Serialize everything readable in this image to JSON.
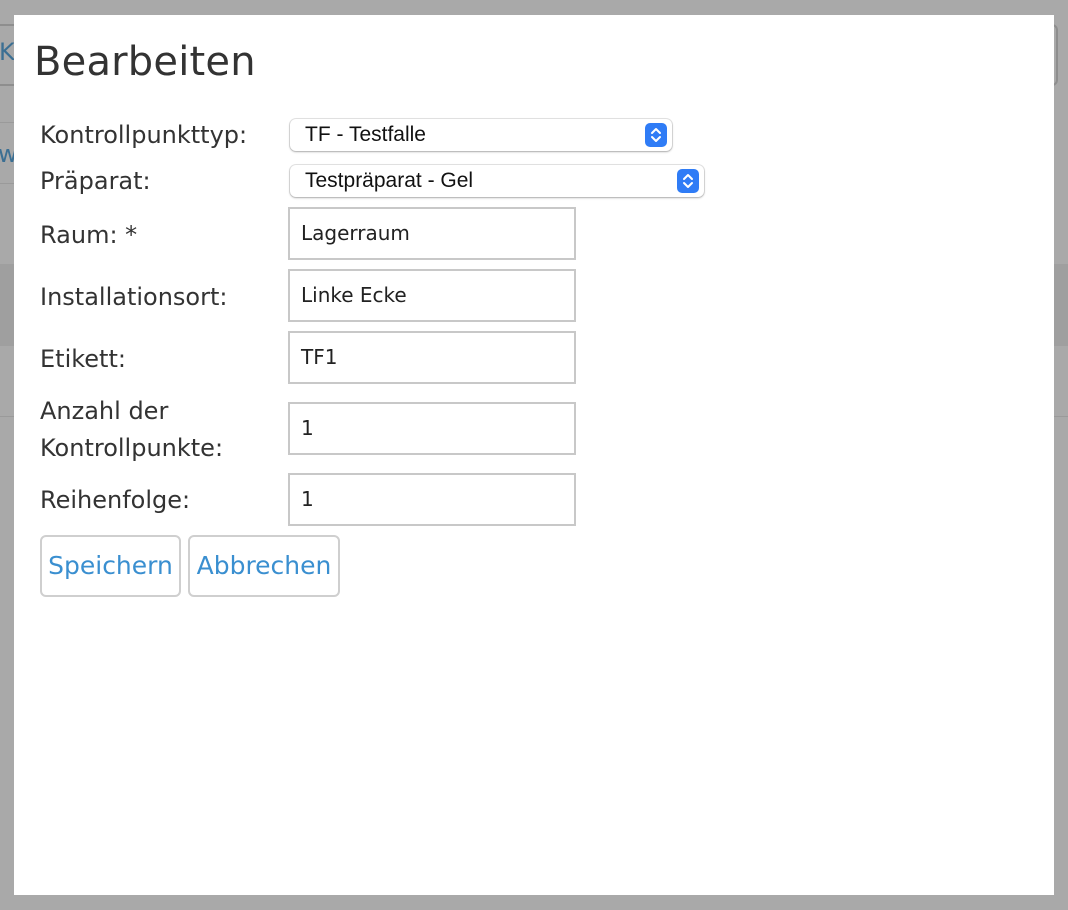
{
  "background": {
    "fragment_top": "K",
    "fragment_mid": "w"
  },
  "dialog": {
    "title": "Bearbeiten",
    "fields": {
      "kontrollpunkttyp": {
        "label": "Kontrollpunkttyp:",
        "value": "TF - Testfalle"
      },
      "praeparat": {
        "label": "Präparat:",
        "value": "Testpräparat - Gel"
      },
      "raum": {
        "label": "Raum: *",
        "value": "Lagerraum"
      },
      "installationsort": {
        "label": "Installationsort:",
        "value": "Linke Ecke"
      },
      "etikett": {
        "label": "Etikett:",
        "value": "TF1"
      },
      "anzahl": {
        "label_line1": "Anzahl der",
        "label_line2": "Kontrollpunkte:",
        "value": "1"
      },
      "reihenfolge": {
        "label": "Reihenfolge:",
        "value": "1"
      }
    },
    "buttons": {
      "save": "Speichern",
      "cancel": "Abbrechen"
    }
  },
  "colors": {
    "link_blue": "#3a8fd0",
    "select_arrow_blue": "#2f7cf6",
    "overlay": "#a9a9a9"
  },
  "icons": {
    "select_arrows": "up-down-chevron-icon"
  }
}
